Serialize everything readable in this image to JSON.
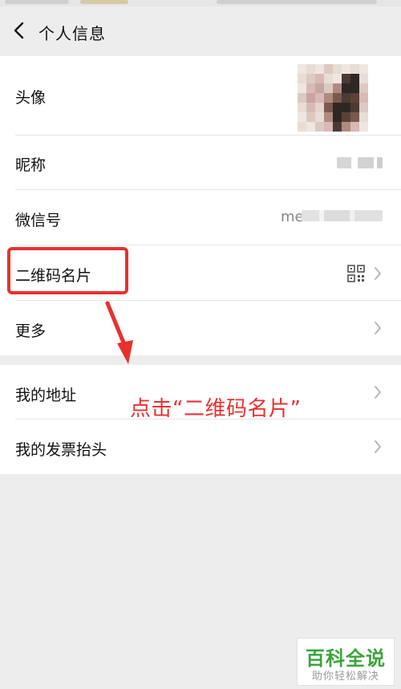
{
  "header": {
    "title": "个人信息"
  },
  "profile_rows": [
    {
      "label": "头像"
    },
    {
      "label": "昵称"
    },
    {
      "label": "微信号",
      "value_prefix": "me"
    },
    {
      "label": "二维码名片"
    },
    {
      "label": "更多"
    }
  ],
  "extra_rows": [
    {
      "label": "我的地址"
    },
    {
      "label": "我的发票抬头"
    }
  ],
  "annotation": {
    "text": "点击“二维码名片”",
    "color": "#e8312f"
  },
  "watermark": {
    "title": "百科全说",
    "subtitle": "助你轻松解决",
    "color": "#3aa53a"
  },
  "icons": [
    "back-arrow",
    "avatar-image",
    "qr-code",
    "chevron-right"
  ]
}
